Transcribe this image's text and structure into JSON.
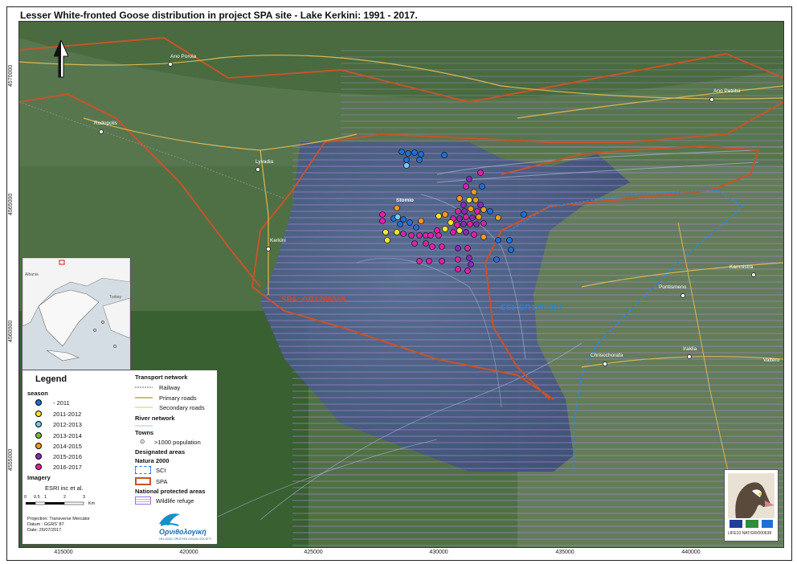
{
  "title": "Lesser White-fronted Goose distribution in project SPA site - Lake Kerkini: 1991 - 2017.",
  "x_ticks": [
    "415000",
    "420000",
    "425000",
    "430000",
    "435000",
    "440000"
  ],
  "y_ticks": [
    "4570000",
    "4565000",
    "4560000",
    "4555000"
  ],
  "places": [
    {
      "name": "Ano Poroia"
    },
    {
      "name": "Ano Petritsi"
    },
    {
      "name": "Rodopolis"
    },
    {
      "name": "Lyvadia"
    },
    {
      "name": "Kerkini"
    },
    {
      "name": "Stomio"
    },
    {
      "name": "Kamnistra"
    },
    {
      "name": "Pontismeno"
    },
    {
      "name": "Chrisochorafa"
    },
    {
      "name": "Iraklia"
    },
    {
      "name": "Valtero"
    }
  ],
  "area_labels": {
    "spa": "SPA: GR1260008",
    "sci": "SCI: GR1260001"
  },
  "legend": {
    "title": "Legend",
    "season_head": "season",
    "seasons": [
      {
        "label": "- 2011",
        "color": "#1f6fd6"
      },
      {
        "label": "2011-2012",
        "color": "#f5e62a"
      },
      {
        "label": "2012-2013",
        "color": "#79c8e8"
      },
      {
        "label": "2013-2014",
        "color": "#7dbb3c"
      },
      {
        "label": "2014-2015",
        "color": "#f39a1e"
      },
      {
        "label": "2015-2016",
        "color": "#8a2bb5"
      },
      {
        "label": "2016-2017",
        "color": "#e020a8"
      }
    ],
    "imagery_head": "Imagery",
    "imagery": "ESRI inc et al.",
    "transport_head": "Transport network",
    "railway": "Railway",
    "primary": "Primary roads",
    "secondary": "Secondary roads",
    "river_head": "River network",
    "towns_head": "Towns",
    "towns": ">1000 population",
    "designated_head": "Designated areas",
    "natura_head": "Natura 2000",
    "sci": "SCI",
    "spa": "SPA",
    "national_head": "National protected areas",
    "wildlife": "Wildlife refuge",
    "scale": [
      "0",
      "0.5",
      "1",
      "2",
      "3"
    ],
    "scale_unit": "Km",
    "projection": "Projection: Transverse Mercator",
    "datum": "Datum : GGRS' 87",
    "date": "Date: 26/07/2017",
    "org_name": "Ορνιθολογική",
    "org_sub": "HELLENIC ORNITHOLOGICAL SOCIETY"
  },
  "inset": {
    "country_a": "Albania",
    "country_b": "Turkey"
  },
  "project_code": "LIFE10 NAT/GR/000638"
}
